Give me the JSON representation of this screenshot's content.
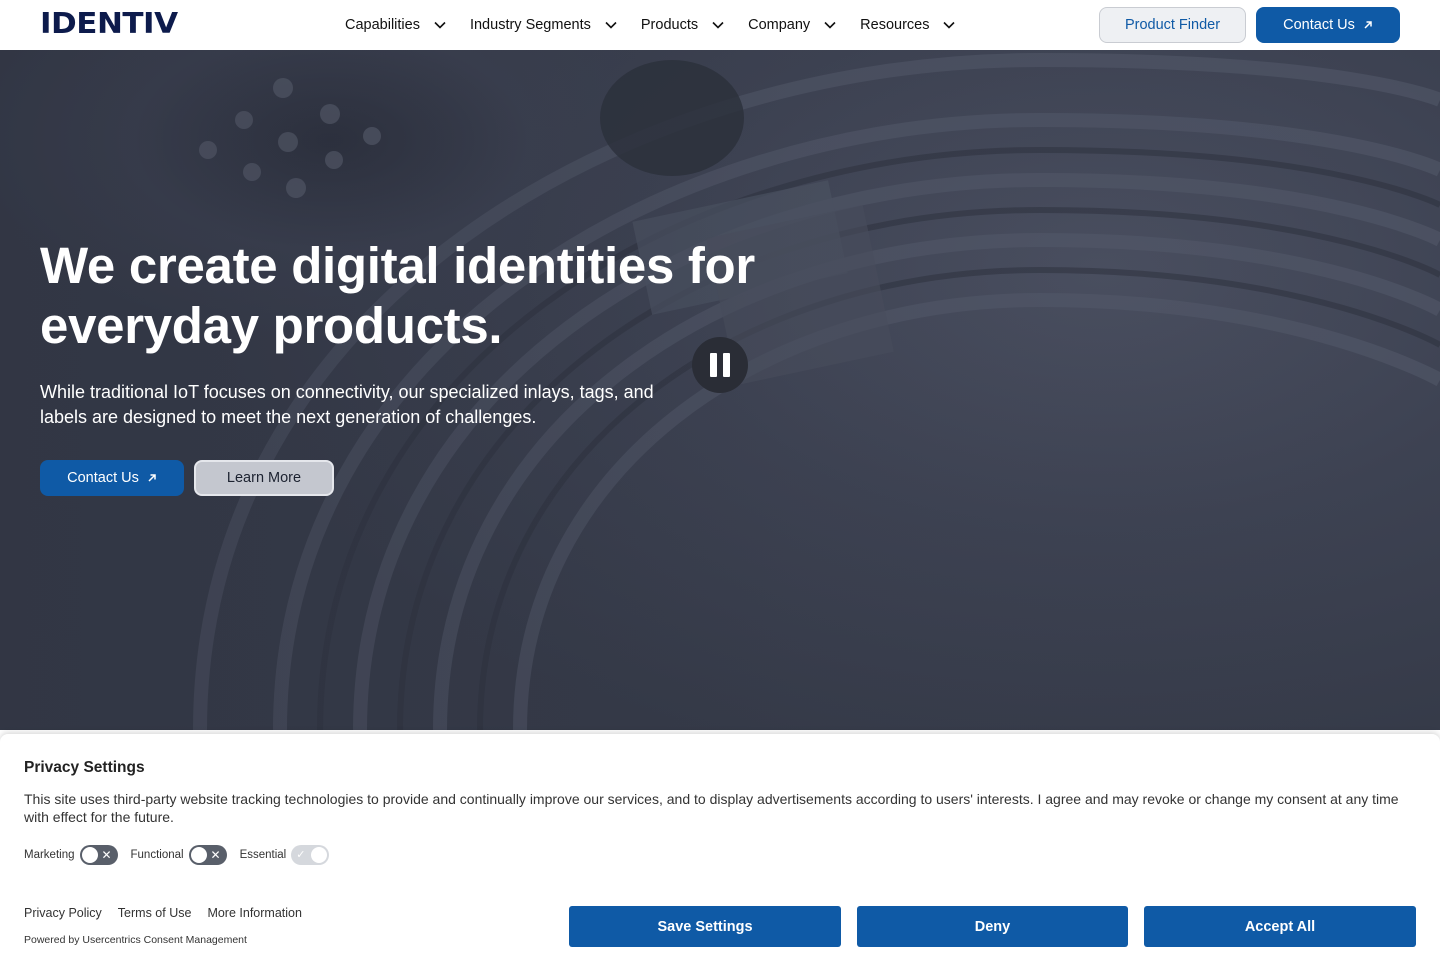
{
  "brand": {
    "logo_text": "IDENTIV",
    "primary_color": "#0f5aa6",
    "logo_color": "#0d1b4c"
  },
  "nav": {
    "items": [
      {
        "label": "Capabilities",
        "icon": "chevron-down-icon"
      },
      {
        "label": "Industry Segments",
        "icon": "chevron-down-icon"
      },
      {
        "label": "Products",
        "icon": "chevron-down-icon"
      },
      {
        "label": "Company",
        "icon": "chevron-down-icon"
      },
      {
        "label": "Resources",
        "icon": "chevron-down-icon"
      }
    ],
    "product_finder_label": "Product Finder",
    "contact_label": "Contact Us",
    "contact_icon": "arrow-up-right-icon"
  },
  "hero": {
    "title": "We create digital identities for everyday products.",
    "subtitle": "While traditional IoT focuses on connectivity, our specialized inlays, tags, and labels are designed to meet the next generation of challenges.",
    "contact_label": "Contact Us",
    "learn_more_label": "Learn More",
    "pause_icon": "pause-icon"
  },
  "consent": {
    "title": "Privacy Settings",
    "text": "This site uses third-party website tracking technologies to provide and continually improve our services, and to display advertisements according to users' interests. I agree and may revoke or change my consent at any time with effect for the future.",
    "toggles": [
      {
        "label": "Marketing",
        "state": "off"
      },
      {
        "label": "Functional",
        "state": "off"
      },
      {
        "label": "Essential",
        "state": "on-disabled"
      }
    ],
    "links": [
      "Privacy Policy",
      "Terms of Use",
      "More Information"
    ],
    "powered_by": "Powered by Usercentrics Consent Management",
    "buttons": {
      "save": "Save Settings",
      "deny": "Deny",
      "accept": "Accept All"
    }
  }
}
